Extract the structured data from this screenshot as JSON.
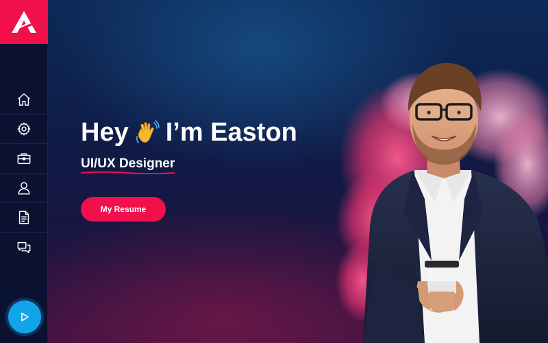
{
  "sidebar": {
    "logo": "logo-icon",
    "items": [
      {
        "icon": "home-icon"
      },
      {
        "icon": "gear-icon"
      },
      {
        "icon": "briefcase-icon"
      },
      {
        "icon": "user-icon"
      },
      {
        "icon": "document-icon"
      },
      {
        "icon": "chat-icon"
      }
    ],
    "play_button": "play-icon"
  },
  "hero": {
    "greeting": "Hey",
    "wave": "waving-hand-icon",
    "name": "I’m Easton",
    "role": "UI/UX Designer",
    "button_label": "My Resume"
  },
  "colors": {
    "accent": "#f0104c",
    "sidebar_bg": "#0b1131",
    "play_button": "#12a4ea",
    "background": "#0d2a58"
  },
  "portrait": {
    "subject": "man-with-glasses-holding-coffee-cup",
    "backdrop": "pink-smoke-cloud"
  }
}
